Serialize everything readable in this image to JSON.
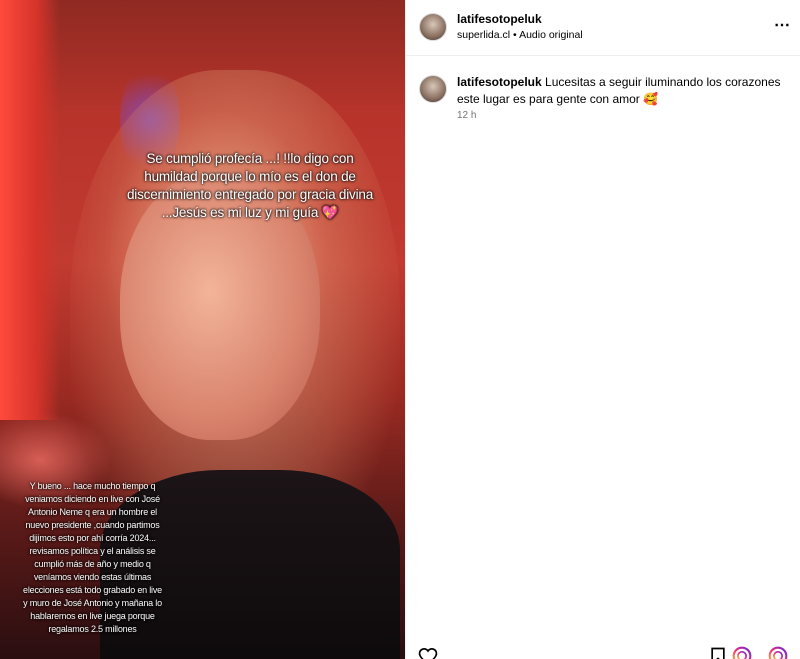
{
  "post": {
    "username": "latifesotopeluk",
    "subline_left": "superlida.cl",
    "subline_sep": " • ",
    "subline_right": "Audio original",
    "more_icon": "more-horizontal-icon"
  },
  "media": {
    "story_top": "Se cumplió profecía ...! !!lo digo con humildad porque lo mío es el don de discernimiento entregado por gracia divina ...Jesús es mi luz y mi guía 💖",
    "story_bottom": "Y bueno ... hace mucho tiempo q veniamos diciendo en live con José Antonio Neme q era un hombre el nuevo presidente ,cuando partimos dijimos esto por ahí corría 2024... revisamos política y el análisis se cumplió más de año y medio q veníamos viendo estas últimas elecciones está todo grabado en live y muro de José Antonio y mañana lo hablaremos en live juega porque regalamos 2.5 millones"
  },
  "comment": {
    "username": "latifesotopeluk",
    "text": " Lucesitas a seguir iluminando los corazones este lugar es para gente con amor 🥰",
    "time": "12 h"
  },
  "actions": {
    "icons": [
      "heart-icon",
      "bookmark-icon",
      "instagram-icon",
      "instagram-icon"
    ]
  },
  "colors": {
    "text": "#000000",
    "muted": "#737373",
    "border": "#efefef"
  }
}
